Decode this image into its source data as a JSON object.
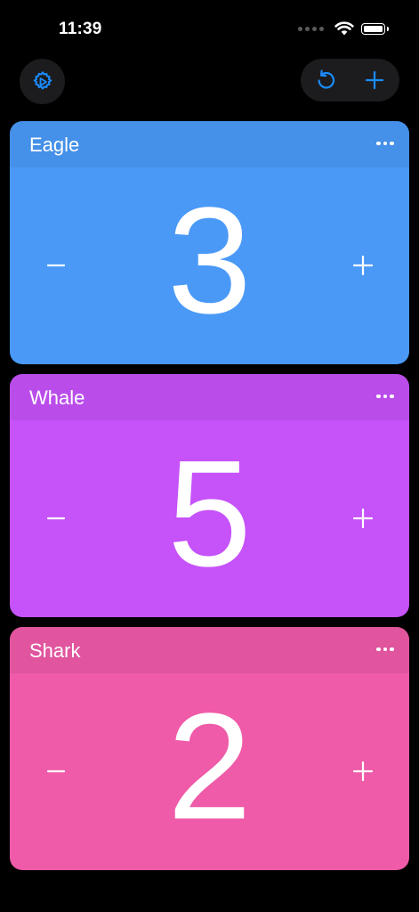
{
  "status_bar": {
    "time": "11:39"
  },
  "toolbar": {
    "settings_icon": "gear-play-icon",
    "reset_icon": "counterclockwise-arrow-icon",
    "add_icon": "plus-icon",
    "accent_color": "#1a8cff",
    "button_bg": "#1c1c1e"
  },
  "counters": [
    {
      "name": "Eagle",
      "count": "3",
      "color": "#4a99f7"
    },
    {
      "name": "Whale",
      "count": "5",
      "color": "#c652f9"
    },
    {
      "name": "Shark",
      "count": "2",
      "color": "#ef5ba8"
    }
  ]
}
